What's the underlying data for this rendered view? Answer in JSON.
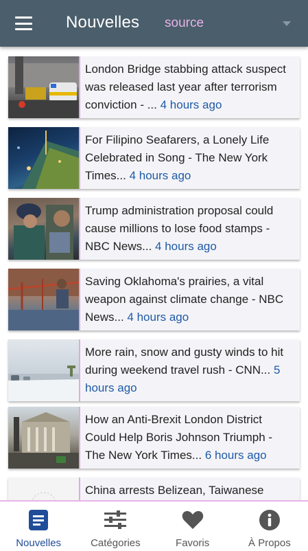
{
  "appbar": {
    "title": "Nouvelles",
    "source_label": "source"
  },
  "feed": {
    "items": [
      {
        "title": "London Bridge stabbing attack suspect was released last year after terrorism conviction - ...",
        "time": "4 hours ago"
      },
      {
        "title": "For Filipino Seafarers, a Lonely Life Celebrated in Song - The New York Times...",
        "time": "4 hours ago"
      },
      {
        "title": "Trump administration proposal could cause millions to lose food stamps - NBC News...",
        "time": "4 hours ago"
      },
      {
        "title": "Saving Oklahoma's prairies, a vital weapon against climate change - NBC News...",
        "time": "4 hours ago"
      },
      {
        "title": "More rain, snow and gusty winds to hit during weekend travel rush - CNN...",
        "time": "5 hours ago"
      },
      {
        "title": "How an Anti-Brexit London District Could Help Boris Johnson Triumph - The New York Times...",
        "time": "6 hours ago"
      },
      {
        "title": "China arrests Belizean, Taiwanese",
        "time": ""
      }
    ]
  },
  "bottom_nav": {
    "items": [
      {
        "label": "Nouvelles",
        "icon": "news-icon",
        "active": true
      },
      {
        "label": "Catégories",
        "icon": "sliders-icon",
        "active": false
      },
      {
        "label": "Favoris",
        "icon": "heart-icon",
        "active": false
      },
      {
        "label": "À Propos",
        "icon": "info-icon",
        "active": false
      }
    ]
  },
  "colors": {
    "appbar": "#4b5e6b",
    "accent_pink": "#e6b3e8",
    "link_blue": "#1f5aa6",
    "nav_active": "#1f4d99"
  }
}
